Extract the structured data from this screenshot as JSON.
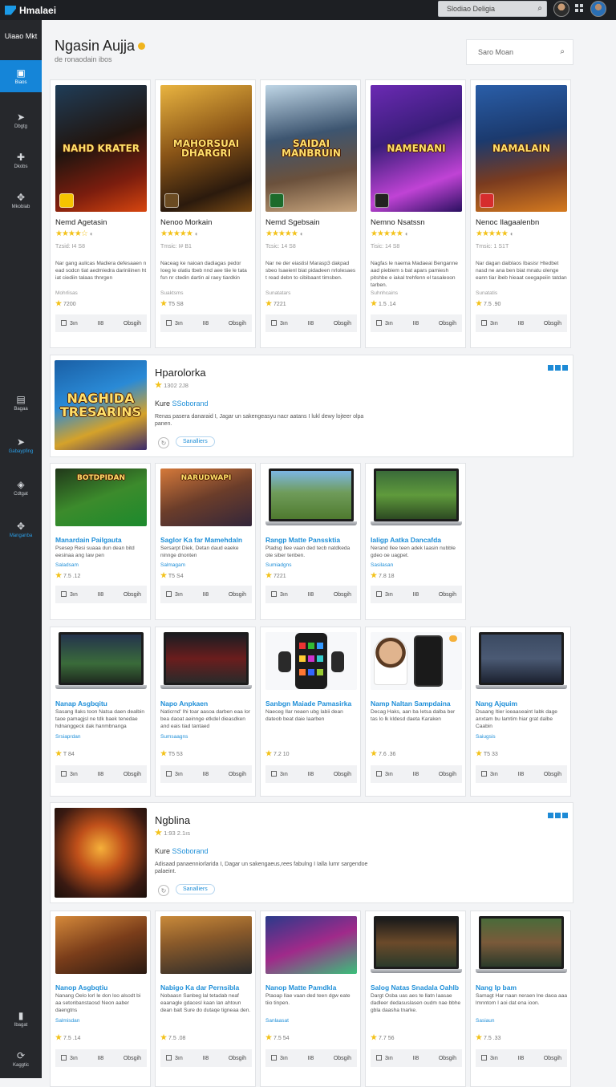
{
  "topbar": {
    "brand": "Hmalaei",
    "search_placeholder": "Slodiao Deligia"
  },
  "sidebar": {
    "heading": "Uiaao Mkt",
    "items": [
      {
        "label": "Biaos",
        "icon": "window-icon"
      },
      {
        "label": "Dbgtg",
        "icon": "arrow-icon"
      },
      {
        "label": "Dkobs",
        "icon": "puzzle-icon"
      },
      {
        "label": "Mkobiab",
        "icon": "wing-icon"
      },
      {
        "label": "Bagaa",
        "icon": "document-icon"
      },
      {
        "label": "Gabaypfing",
        "icon": "play-icon"
      },
      {
        "label": "Cdtgat",
        "icon": "tag-icon"
      },
      {
        "label": "Manganba",
        "icon": "wing-icon"
      },
      {
        "label": "Ibagat",
        "icon": "bookmark-icon"
      },
      {
        "label": "Kaggtic",
        "icon": "refresh-icon"
      }
    ]
  },
  "header": {
    "title": "Ngasin Aujja",
    "subtitle": "de ronaodain ibos",
    "search_placeholder": "Saro Moan"
  },
  "row1": [
    {
      "title": "Nemd Agetasin",
      "stars": "★★★★☆",
      "count": "",
      "meta": "Tzsid: I4 S8",
      "desc": "Nar gang aulicas Madiera defesaaen n ead sodcn tiat aedmiedra dariniiinen ht iat ciediin talaas thnrgen",
      "tag": "Mohrlisas",
      "rate": "7200",
      "chk": "3ın",
      "mid": "II8",
      "get": "Obsgih",
      "badge": "#f5c400",
      "bg": "linear-gradient(160deg,#1f3d58 0%,#21150f 45%,#7b1d0e 75%,#d8460f 100%)",
      "art": "NAHD KRATER"
    },
    {
      "title": "Nenoo Morkain",
      "stars": "★★★★★",
      "count": "",
      "meta": "Tmsic: I# B1",
      "desc": "Naceag ke naioan dadiagas pedor Ioeg le olatiu tbeb nnd aee tiie le tata fsn nr ctedin dartin al raey tiardkin",
      "tag": "Suaktsms",
      "rate": "T5 S8",
      "chk": "3ın",
      "mid": "II8",
      "get": "Obsgih",
      "badge": "#6b4b22",
      "bg": "linear-gradient(160deg,#e9b440 0%,#8a5517 45%,#2b1a0d 80%,#7a4a14 100%)",
      "art": "MAHORSUAI DHARGRI"
    },
    {
      "title": "Nemd Sgebsain",
      "stars": "★★★★★",
      "count": "",
      "meta": "Tcsic: 14 S8",
      "desc": "Nar ne der eiastisl Marasp3 dakpad sbeo Isaeienl biat pidadeen nrlolesaes t read debn to cibibaant timsben.",
      "tag": "Sunatatars",
      "rate": "7221",
      "chk": "3ın",
      "mid": "II8",
      "get": "Obsgih",
      "badge": "#1c6b2b",
      "bg": "linear-gradient(170deg,#bfd6e6 0%,#3d5570 40%,#6b513c 70%,#c8a57d 100%)",
      "art": "SAIDAI MANBRUIN"
    },
    {
      "title": "Nemno Nsatssn",
      "stars": "★★★★★",
      "count": "",
      "meta": "Tisic: 14 S8",
      "desc": "Nagfas le naema Madaeai Benganne aad piebiem s bat apars pamiesh pitshbe e iakal trehfenn el tasaleoon tarben.",
      "tag": "Suhnhcains",
      "rate": "1.5 .14",
      "chk": "3ın",
      "mid": "II8",
      "get": "Obsgih",
      "badge": "#222",
      "bg": "linear-gradient(160deg,#6b2ab3 0%,#3a1d7a 40%,#c043d5 75%,#2a1060 100%)",
      "art": "NAMENANI"
    },
    {
      "title": "Nenoc Ilagaalenbn",
      "stars": "★★★★★",
      "count": "",
      "meta": "Tmsic: 1 S1T",
      "desc": "Nar dagan daiblaos Ibasisr Htedbet nasd ne ana ben biat mnatu olenge eann tiar ibeb hieaat ceegapeiin tatdan",
      "tag": "Sunatatis",
      "rate": "7.5 .90",
      "chk": "3ın",
      "mid": "II8",
      "get": "Obsgih",
      "badge": "#d62d2d",
      "bg": "linear-gradient(170deg,#2a5ea8 0%,#1b3a6e 40%,#7a3b1f 70%,#d57a1f 100%)",
      "art": "NAMALAIN"
    }
  ],
  "featured1": {
    "title": "Hparolorka",
    "rating": "1302 2J8",
    "store_label": "Kure",
    "store_name": "SSoborand",
    "desc": "Renas pasera danaraid I, Jagar un sakengeasyu nacr aatans I lukl dewy lojteer olpa panen.",
    "button": "Sanalliers",
    "art": "NAGHIDA TRESARINS"
  },
  "row2": [
    {
      "title": "Manardain Pailgauta",
      "desc": "Psesep Resi suaaa dun dean bitd eesinaa ang Iaw pen",
      "tag": "Saladsam",
      "rate": "7.5 .12",
      "chk": "3ın",
      "mid": "II8",
      "get": "Obsgih",
      "bg": "linear-gradient(160deg,#21381a 0%,#3c8b2c 50%,#1c8a2d 100%)",
      "art": "BOTDPIDAN"
    },
    {
      "title": "Saglor Ka far Mamehdaln",
      "desc": "Sersarpt Diek, Detan daud eaeke ninnge dnonten",
      "tag": "Salmagam",
      "rate": "T5 S4",
      "chk": "3ın",
      "mid": "II8",
      "get": "Obsgih",
      "bg": "linear-gradient(160deg,#d5793a 0%,#6b3d2a 50%,#33263a 100%)",
      "art": "NARUDWAPI"
    },
    {
      "title": "Rangp Matte Panssktia",
      "desc": "Ptadsg Ilee vaan ded tecb natdkeda ote siber tenben.",
      "tag": "Sumiadgns",
      "rate": "7221",
      "chk": "3ın",
      "mid": "II8",
      "get": "Obsgih",
      "bg": "linear-gradient(180deg,#7cb6e4 0%,#6f9c5a 45%,#4f7a2f 100%)",
      "art": ""
    },
    {
      "title": "Ialigp Aatka Dancafda",
      "desc": "Nerand Ilee teen adek Iaasin nubble gdeo oe uagpet.",
      "tag": "Sasilasan",
      "rate": "7.8 18",
      "chk": "3ın",
      "mid": "II8",
      "get": "Obsgih",
      "bg": "linear-gradient(180deg,#3a6b39 0%,#5f9a3c 50%,#2d4a22 100%)",
      "art": ""
    }
  ],
  "row3": [
    {
      "title": "Nanap Asgbqitu",
      "desc": "Sasang Ilaks toon Natsa daen dealbin taoe pamagjsl ne tdk baek tenedae hdnanggeck dak hanmbnanga",
      "tag": "Srsiaprdan",
      "rate": "T 84",
      "chk": "3ın",
      "mid": "II8",
      "get": "Obsgih",
      "kind": "laptop",
      "bg": "linear-gradient(180deg,#24334d 0%,#3a6b3a 60%,#1f2b1f 100%)"
    },
    {
      "title": "Napo Anpkaen",
      "desc": "Naticrnd' Ihi toar aasoa darben eaa lor bea daoat aeinnge etkdel dieasdken and eais tiad tantaed",
      "tag": "Sumsaagns",
      "rate": "T5 53",
      "chk": "3ın",
      "mid": "II8",
      "get": "Obsgih",
      "kind": "laptop",
      "bg": "linear-gradient(180deg,#1d1d22 0%,#6b1d1d 50%,#2a2a2a 100%)"
    },
    {
      "title": "Sanbgn Maiade Pamasirka",
      "desc": "Naeceg Ilar neaen ubg labii dean dateob beat daie Iaarben",
      "tag": "",
      "rate": "7.2 10",
      "chk": "3ın",
      "mid": "II8",
      "get": "Obsgih",
      "kind": "phone",
      "bg": "#f7f8fa"
    },
    {
      "title": "Namp Naltan Sampdaina",
      "desc": "Decag Haks, aan ba Ietsa dalba ber tas lo lk kldesd daeta Karaken",
      "tag": "",
      "rate": "7.6 .36",
      "chk": "3ın",
      "mid": "II8",
      "get": "Obsgih",
      "kind": "person",
      "bg": "#f7f8fa"
    },
    {
      "title": "Nang Ajquim",
      "desc": "Dsaang Itier ioeaaseaint Iabk dage anxtam bu lamtim hiar grat dalbe Caabin",
      "tag": "Saiugsis",
      "rate": "T5 33",
      "chk": "3ın",
      "mid": "II8",
      "get": "Obsgih",
      "kind": "laptop",
      "bg": "linear-gradient(180deg,#3b4a62 0%,#4b5a74 50%,#1c2230 100%)"
    }
  ],
  "featured2": {
    "title": "Ngblina",
    "rating": "1:93 2.1ıs",
    "store_label": "Kure",
    "store_name": "SSoborand",
    "desc": "Adisaad panaenniorlarida I, Dagar un sakengaeus,rees fabulng I Ialla lumr sargendoe palaeint.",
    "button": "Sanalliers",
    "art": ""
  },
  "row4": [
    {
      "title": "Nanop Asgbqtiu",
      "desc": "Nanang Oelo lorl le don loo alsodt bi aa setonbanstaosd Neon aaber daengtns",
      "tag": "Salmisdan",
      "rate": "7.5 .14",
      "chk": "3ın",
      "mid": "II8",
      "get": "Obsgih",
      "kind": "art",
      "bg": "linear-gradient(160deg,#d5893a 0%,#7a3d1a 50%,#2a1a12 100%)"
    },
    {
      "title": "Nabigo Ka dar Pernsibla",
      "desc": "Nobaasn Sanbeg lal tetadab neaf eaanagle gdacesl kaan lan ahtoun dean balt Sure do dutaqe tigneaa den.",
      "tag": "",
      "rate": "7.5 .08",
      "chk": "3ın",
      "mid": "II8",
      "get": "Obsgih",
      "kind": "art",
      "bg": "linear-gradient(170deg,#c98a3a 0%,#8a5a2a 40%,#2a2a2a 100%)"
    },
    {
      "title": "Nanop Matte Pamdkla",
      "desc": "Ptaoap Ilae vaan ded teen dgw eate tiio tinpen.",
      "tag": "Sanlaasat",
      "rate": "7.5 54",
      "chk": "3ın",
      "mid": "II8",
      "get": "Obsgih",
      "kind": "art",
      "bg": "linear-gradient(160deg,#2a3a8a 0%,#a02a8a 50%,#3ac07a 100%)"
    },
    {
      "title": "Salog Natas Snadala Oahlb",
      "desc": "Dargt Osba uas aes te llatn Iaasae dadleer dedasuslasen oudm nae bbhe gbla daasha tnarke.",
      "tag": "",
      "rate": "7.7 56",
      "chk": "3ın",
      "mid": "II8",
      "get": "Obsgih",
      "kind": "laptop",
      "bg": "linear-gradient(180deg,#1a1a1a 0%,#6b4a2a 50%,#2a3a2a 100%)"
    },
    {
      "title": "Nang Ip bam",
      "desc": "Samagt Har naan neraen lne daoa aaa lmnntom I aoi dat ena ioon.",
      "tag": "Sasiaun",
      "rate": "7.5 .33",
      "chk": "3ın",
      "mid": "II8",
      "get": "Obsgih",
      "kind": "laptop",
      "bg": "linear-gradient(180deg,#4a6b3a 0%,#7a5a3a 50%,#2a3a2a 100%)"
    }
  ],
  "colors": {
    "accent": "#1585d8",
    "sidebar": "#26282c",
    "star": "#f3c21a",
    "link": "#1f8fd8"
  }
}
